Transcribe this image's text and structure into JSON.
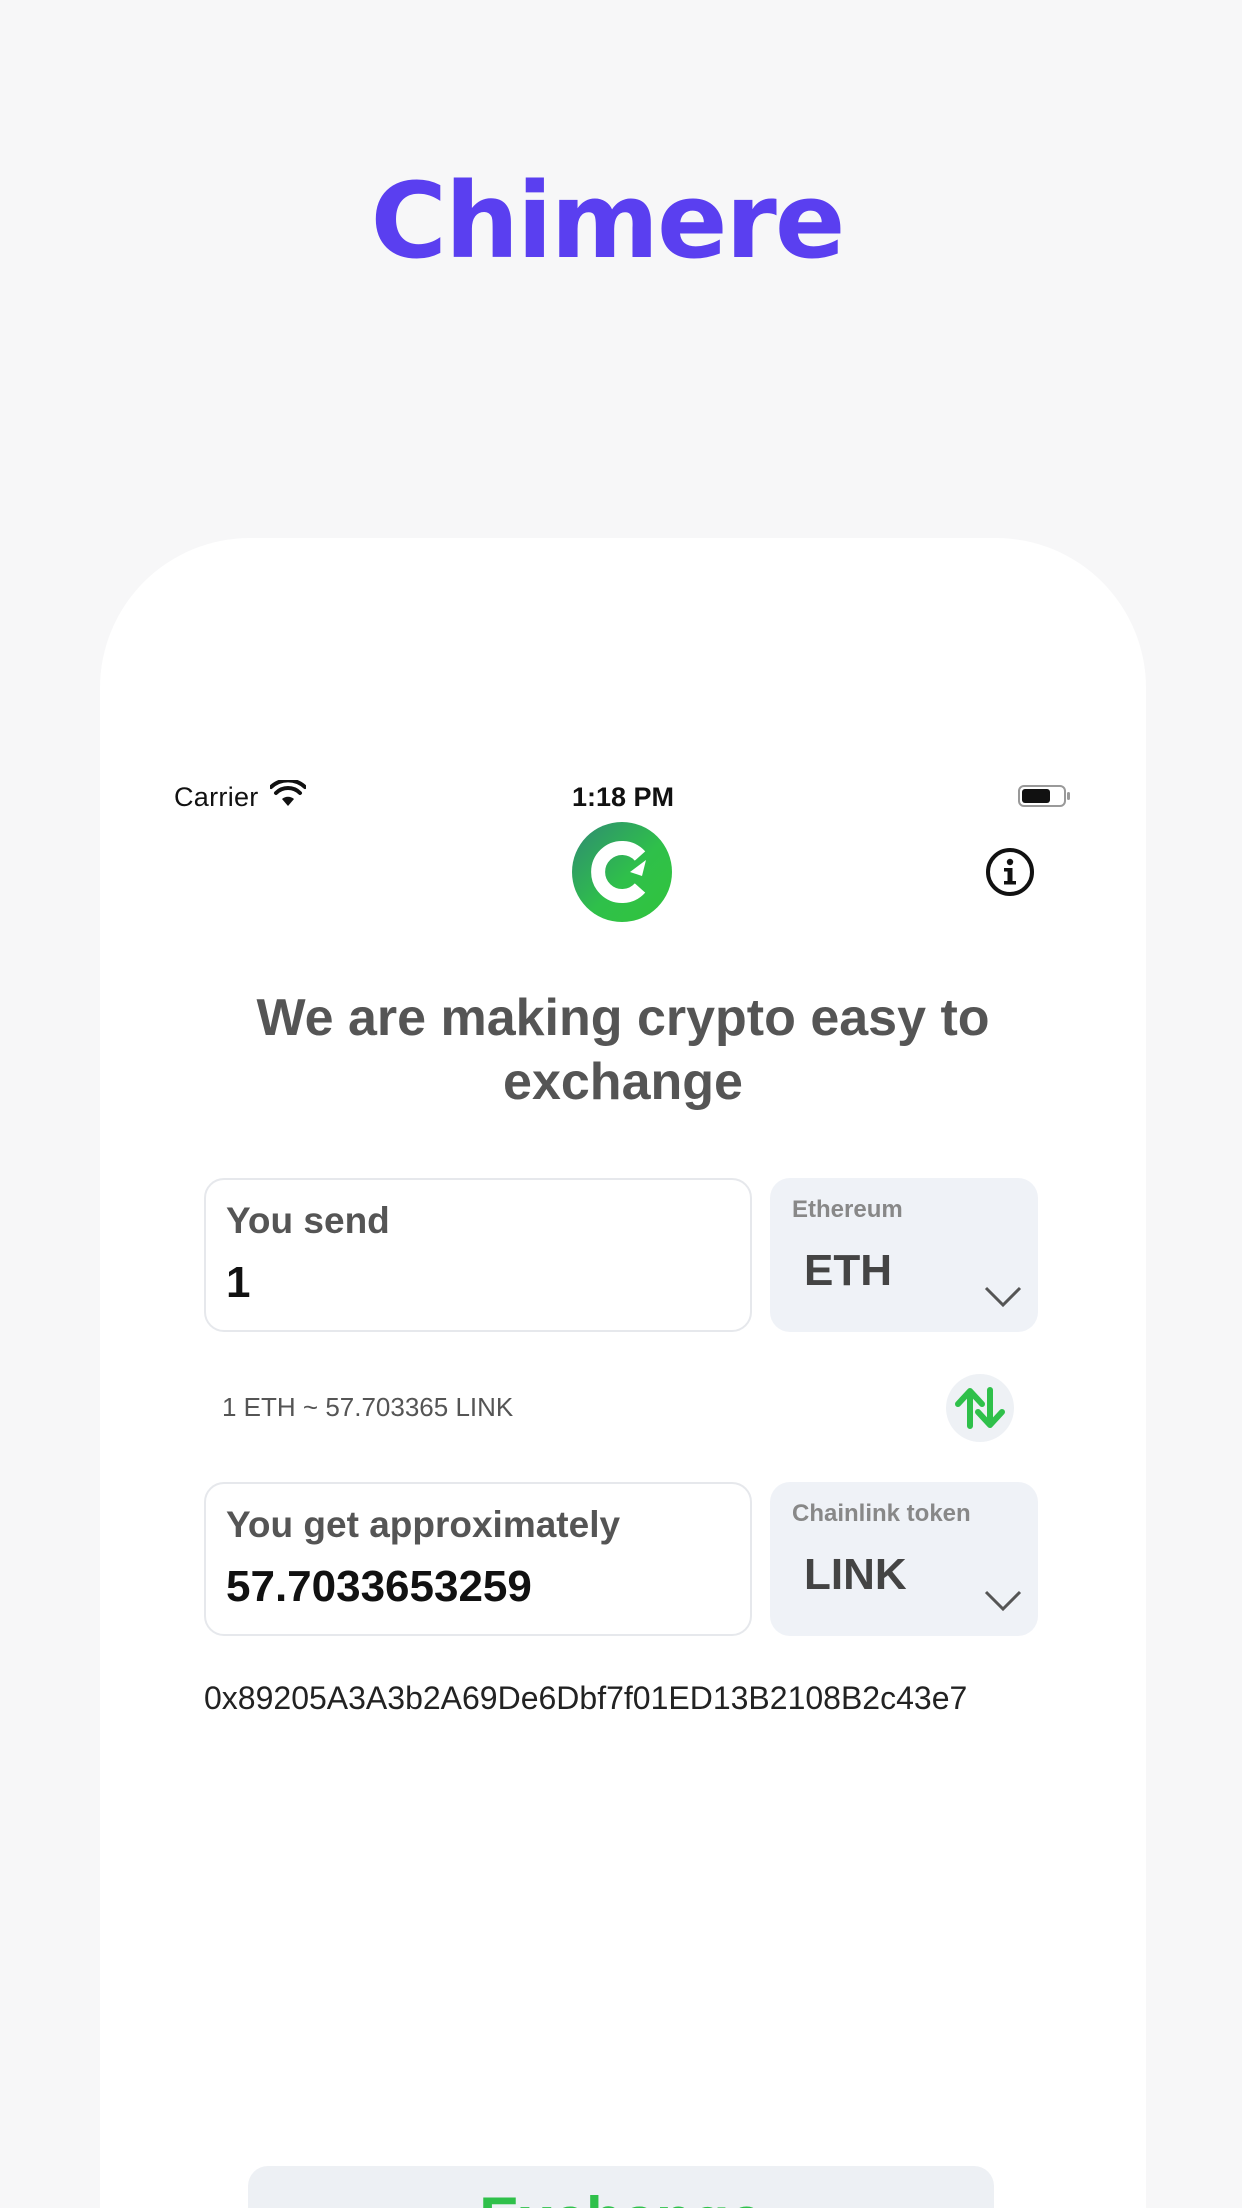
{
  "promo": {
    "headline": "Chimere"
  },
  "status_bar": {
    "carrier": "Carrier",
    "time": "1:18 PM"
  },
  "header": {
    "logo_icon": "chimere-logo-icon",
    "info_icon": "info-icon"
  },
  "tagline": "We are making crypto easy to exchange",
  "send": {
    "label": "You send",
    "value": "1",
    "currency_name": "Ethereum",
    "currency_symbol": "ETH"
  },
  "rate_text": "1 ETH ~ 57.703365 LINK",
  "receive": {
    "label": "You get approximately",
    "value": "57.7033653259",
    "currency_name": "Chainlink token",
    "currency_symbol": "LINK"
  },
  "address": "0x89205A3A3b2A69De6Dbf7f01ED13B2108B2c43e7",
  "exchange_button": {
    "label": "Exchange"
  },
  "colors": {
    "brand_purple": "#5a3ff0",
    "accent_green": "#2fc04a",
    "background": "#f7f7f8",
    "field_gray": "#eff2f7"
  }
}
